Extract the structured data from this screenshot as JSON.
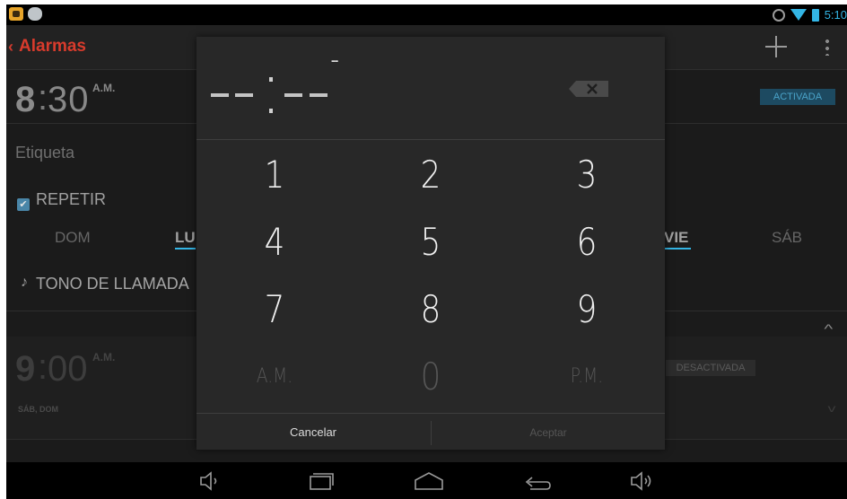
{
  "status_bar": {
    "time": "5:10",
    "icons": [
      "app-notification-icon",
      "cat-notification-icon",
      "alarm-clock-icon",
      "wifi-icon",
      "battery-icon"
    ]
  },
  "action_bar": {
    "title": "Alarmas",
    "actions": [
      "add-icon",
      "overflow-menu-icon"
    ]
  },
  "alarms": [
    {
      "hour": "8",
      "colon": ":",
      "minutes": "30",
      "ampm": "A.M.",
      "status": "ACTIVADA",
      "label": "Etiqueta",
      "repeat_label": "REPETIR",
      "days_visible": [
        "DOM",
        "LU",
        "VIE",
        "SÁB"
      ],
      "ringtone_label": "TONO DE LLAMADA"
    },
    {
      "hour": "9",
      "colon": ":",
      "minutes": "00",
      "ampm": "A.M.",
      "status": "DESACTIVADA",
      "days_summary": "SÁB, DOM"
    }
  ],
  "dialog": {
    "time_placeholder_ampm": "--",
    "keys": {
      "k1": "1",
      "k2": "2",
      "k3": "3",
      "k4": "4",
      "k5": "5",
      "k6": "6",
      "k7": "7",
      "k8": "8",
      "k9": "9",
      "am": "A.M.",
      "k0": "0",
      "pm": "P.M."
    },
    "cancel_label": "Cancelar",
    "accept_label": "Aceptar"
  },
  "colors": {
    "accent": "#33b5e5",
    "title_red": "#d93b2c",
    "dialog_bg": "#282828"
  }
}
